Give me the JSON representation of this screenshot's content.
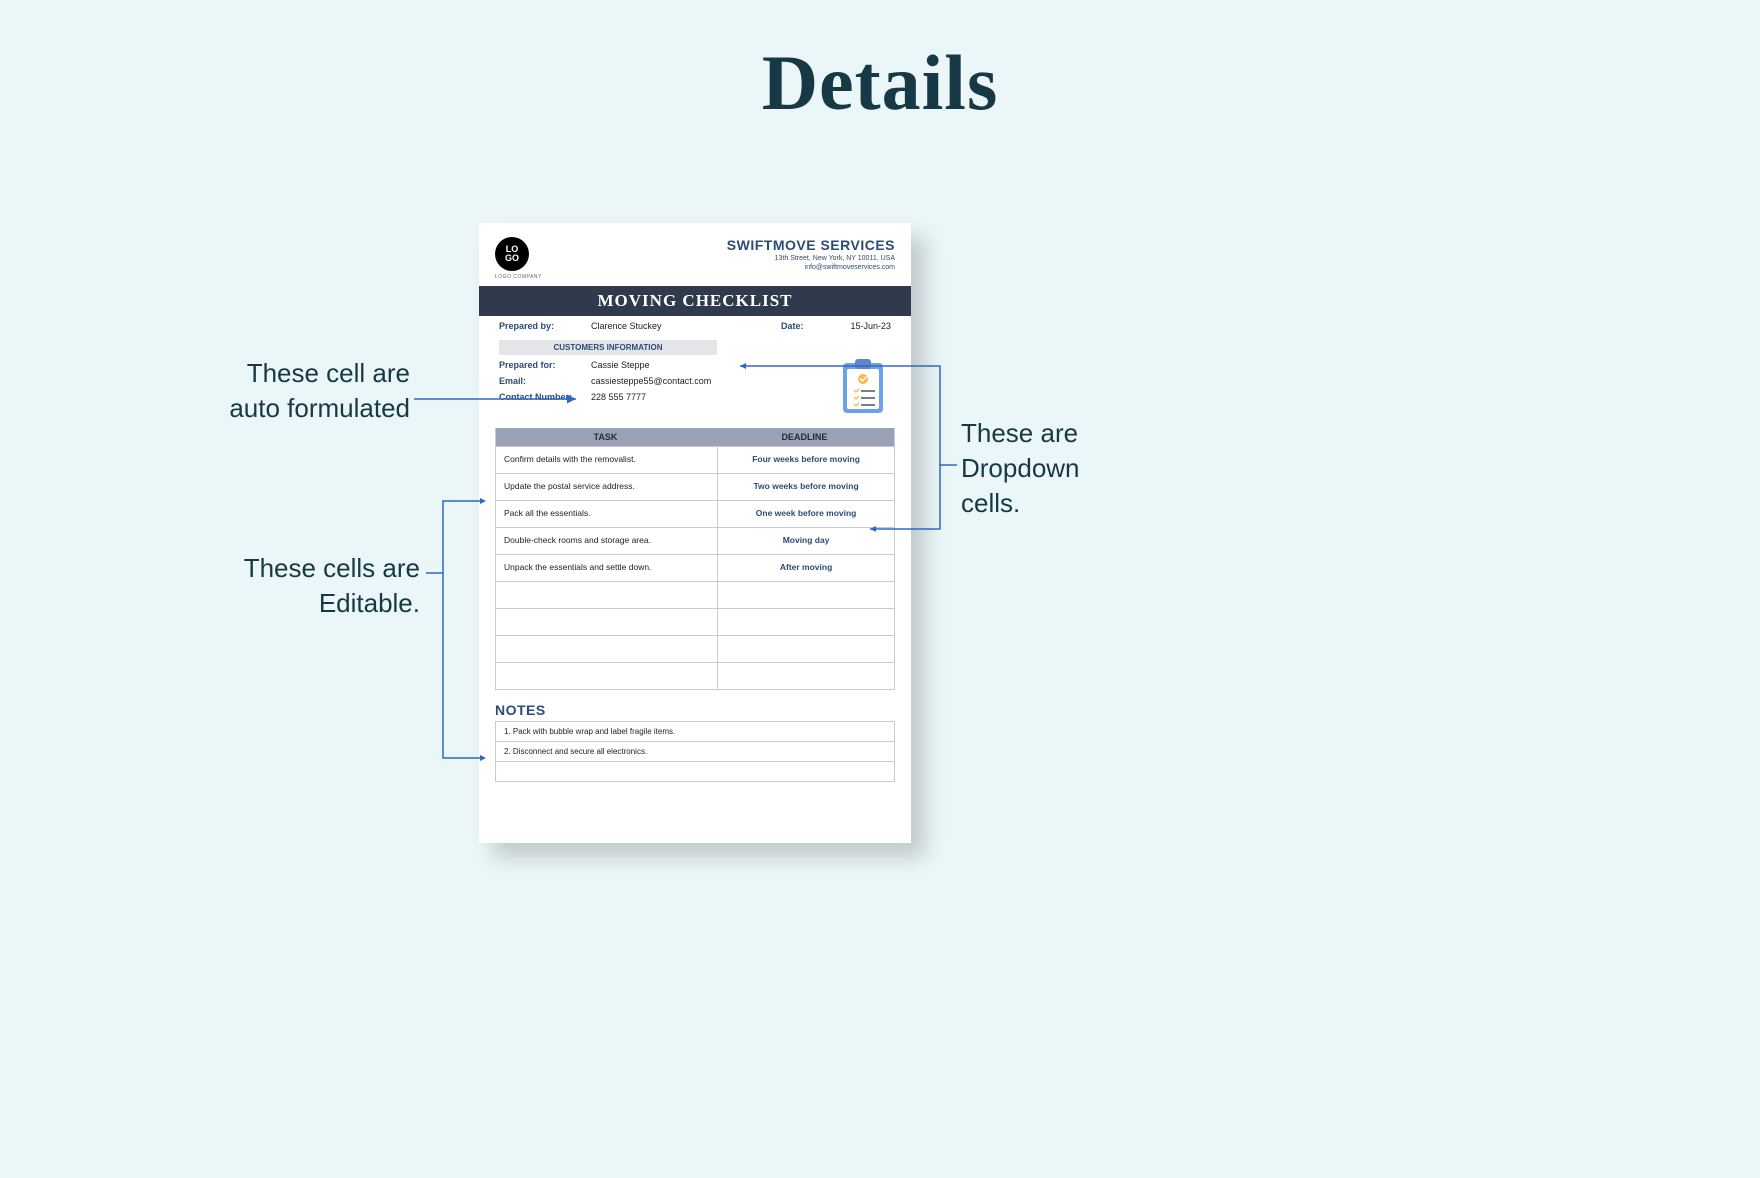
{
  "page_title": "Details",
  "logo": {
    "text": "LO\nGO",
    "subtext": "LOGO COMPANY"
  },
  "company": {
    "name": "SWIFTMOVE SERVICES",
    "address": "13th Street, New York, NY 10011, USA",
    "email": "info@swiftmoveservices.com"
  },
  "banner": "MOVING CHECKLIST",
  "prepared_by": {
    "label": "Prepared by:",
    "value": "Clarence Stuckey"
  },
  "date": {
    "label": "Date:",
    "value": "15-Jun-23"
  },
  "customers_header": "CUSTOMERS INFORMATION",
  "customer": {
    "prepared_for": {
      "label": "Prepared for:",
      "value": "Cassie Steppe"
    },
    "email": {
      "label": "Email:",
      "value": "cassiesteppe55@contact.com"
    },
    "contact": {
      "label": "Contact Number:",
      "value": "228 555 7777"
    }
  },
  "table": {
    "headers": {
      "task": "TASK",
      "deadline": "DEADLINE"
    },
    "rows": [
      {
        "task": "Confirm details with the removalist.",
        "deadline": "Four weeks before moving"
      },
      {
        "task": "Update the postal service address.",
        "deadline": "Two weeks before moving"
      },
      {
        "task": "Pack all the essentials.",
        "deadline": "One week before moving"
      },
      {
        "task": "Double-check rooms and storage area.",
        "deadline": "Moving day"
      },
      {
        "task": "Unpack the essentials and settle down.",
        "deadline": "After moving"
      },
      {
        "task": "",
        "deadline": ""
      },
      {
        "task": "",
        "deadline": ""
      },
      {
        "task": "",
        "deadline": ""
      },
      {
        "task": "",
        "deadline": ""
      }
    ]
  },
  "notes": {
    "title": "NOTES",
    "items": [
      "1. Pack with bubble wrap and label fragile items.",
      "2. Disconnect and secure all electronics.",
      ""
    ]
  },
  "annotations": {
    "auto_formulated": "These cell are<br>auto formulated",
    "editable": "These cells are<br>Editable.",
    "dropdown": "These are<br>Dropdown<br>cells."
  }
}
